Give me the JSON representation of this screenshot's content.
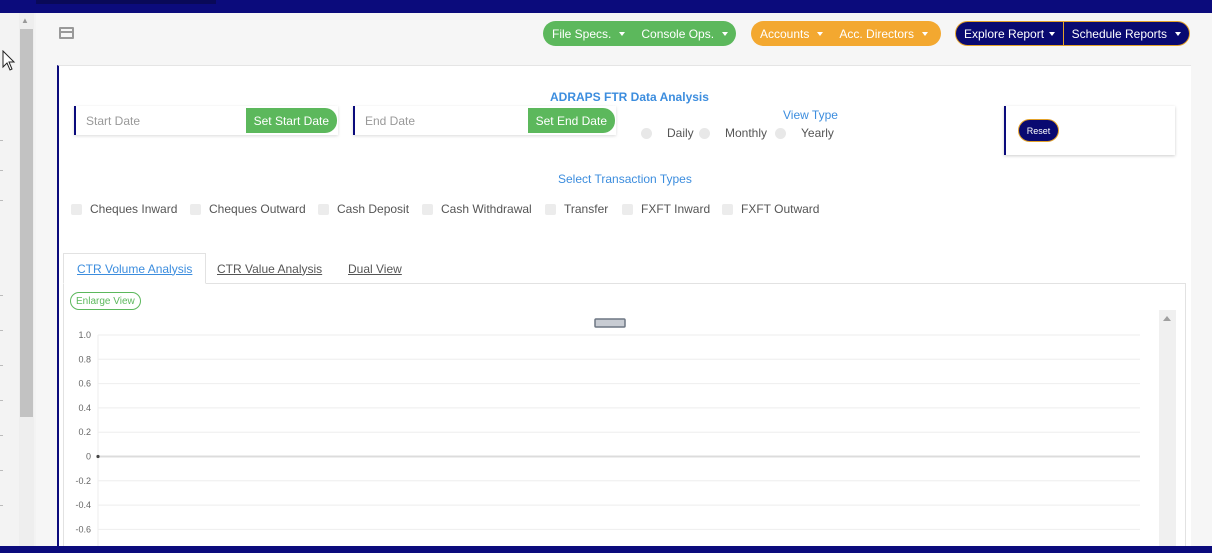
{
  "nav": {
    "file_specs": "File Specs.",
    "console_ops": "Console Ops.",
    "accounts": "Accounts",
    "acc_directors": "Acc. Directors",
    "explore_report": "Explore Report",
    "schedule_reports": "Schedule Reports"
  },
  "filters": {
    "title": "ADRAPS FTR Data Analysis",
    "start_date_placeholder": "Start Date",
    "set_start_date": "Set Start Date",
    "end_date_placeholder": "End Date",
    "set_end_date": "Set End Date",
    "view_type_label": "View Type",
    "view_types": [
      "Daily",
      "Monthly",
      "Yearly"
    ],
    "reset": "Reset",
    "transaction_types_label": "Select Transaction Types",
    "transaction_types": [
      "Cheques Inward",
      "Cheques Outward",
      "Cash Deposit",
      "Cash Withdrawal",
      "Transfer",
      "FXFT Inward",
      "FXFT Outward"
    ]
  },
  "tabs": [
    "CTR Volume Analysis",
    "CTR Value Analysis",
    "Dual View"
  ],
  "enlarge_view": "Enlarge View",
  "colors": {
    "navy": "#0b0b7c",
    "green": "#5cb85c",
    "orange": "#f3a830",
    "link_blue": "#3c8dde"
  },
  "chart_data": {
    "type": "line",
    "title": "",
    "xlabel": "",
    "ylabel": "",
    "ylim": [
      -0.6,
      1.0
    ],
    "y_ticks": [
      "1.0",
      "0.8",
      "0.6",
      "0.4",
      "0.2",
      "0",
      "-0.2",
      "-0.4",
      "-0.6"
    ],
    "x": [
      0
    ],
    "series": [
      {
        "values": [
          0
        ]
      }
    ],
    "grid": true,
    "legend": "top-center"
  }
}
